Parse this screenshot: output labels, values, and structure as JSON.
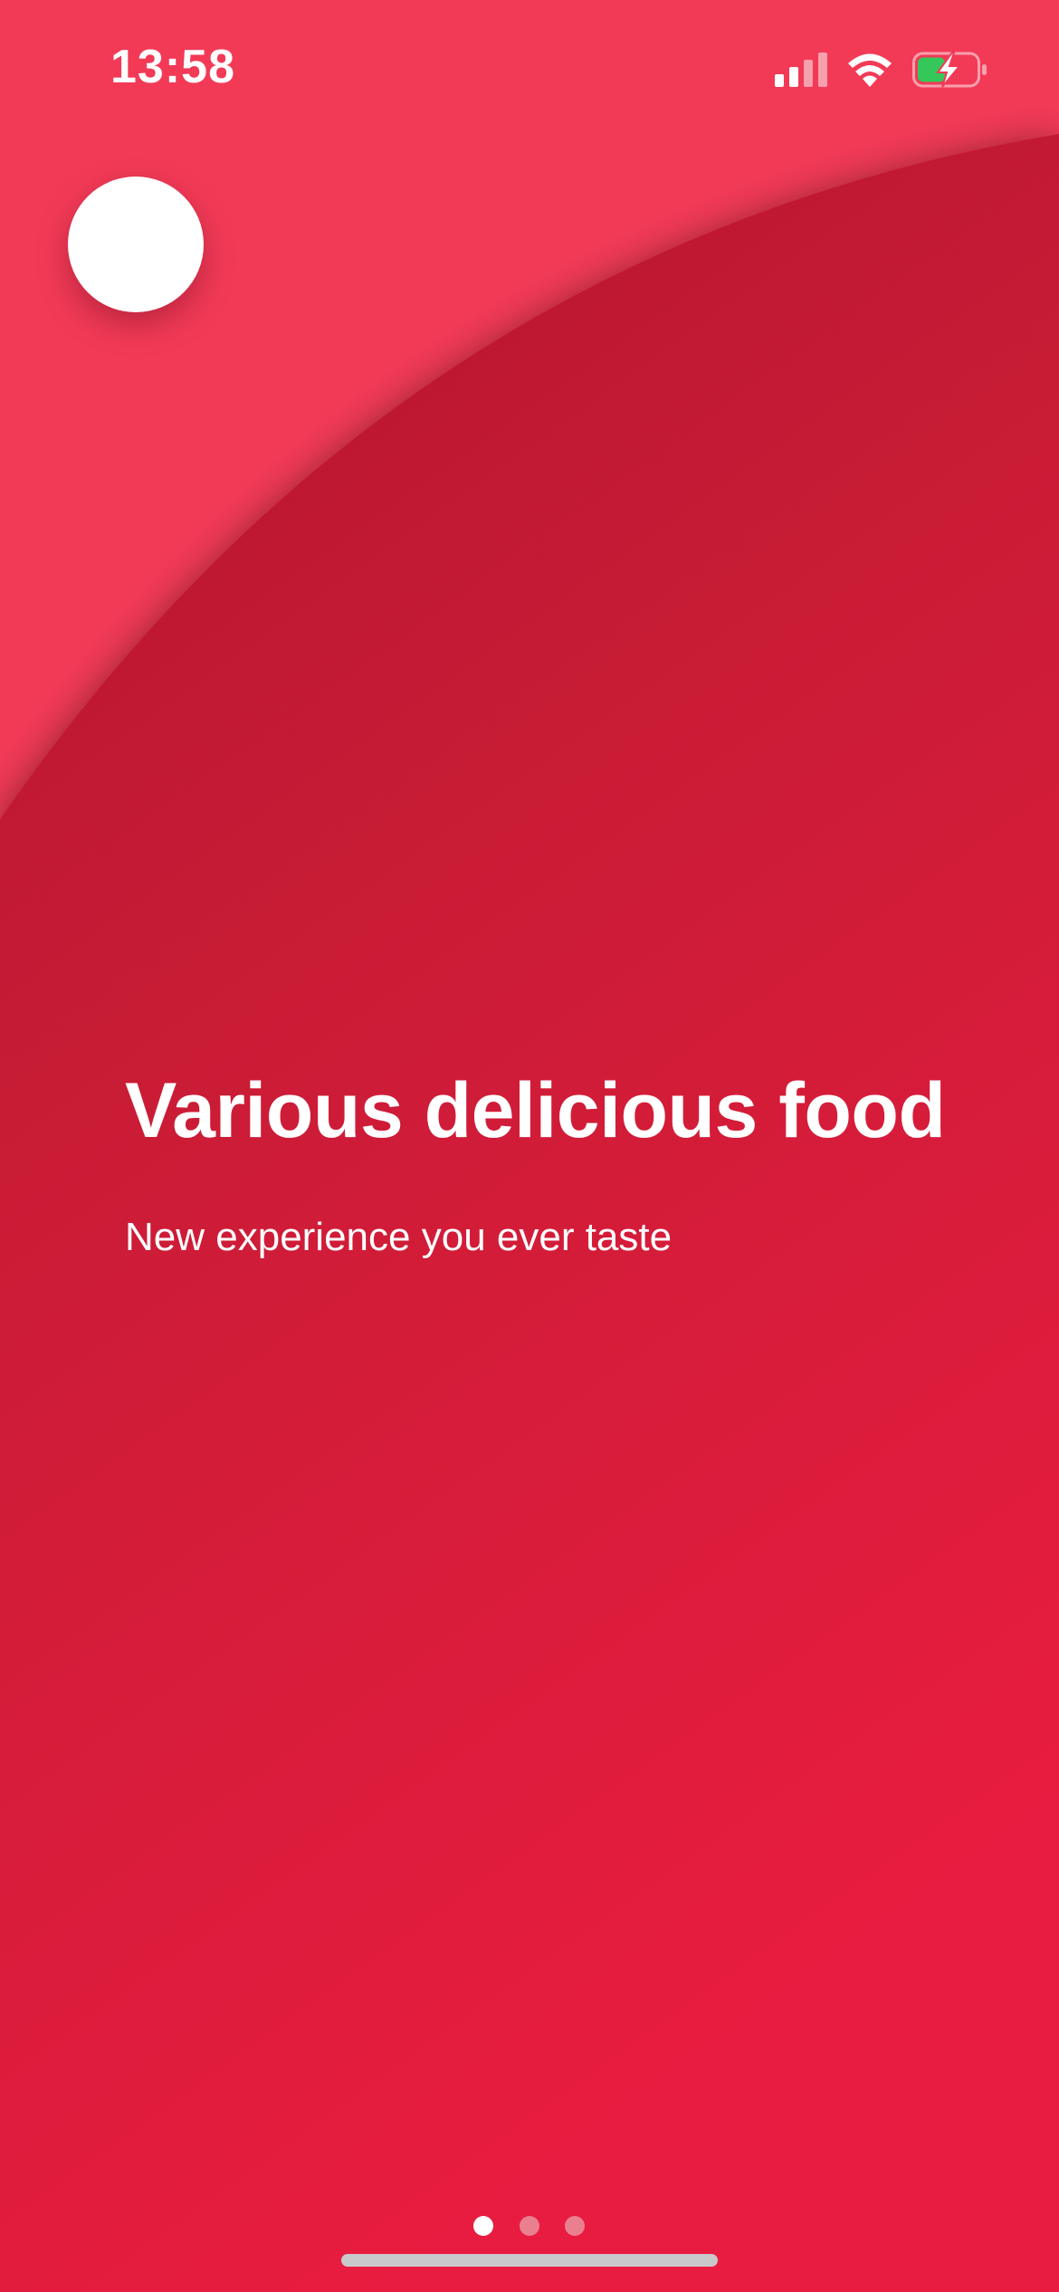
{
  "status_bar": {
    "time": "13:58",
    "signal_icon": "cellular-signal-icon",
    "wifi_icon": "wifi-icon",
    "battery_icon": "battery-charging-icon"
  },
  "onboarding": {
    "title": "Various delicious food",
    "subtitle": "New experience you ever taste",
    "page_indicator": {
      "total_pages": 3,
      "current_page": 1
    }
  },
  "colors": {
    "background_light": "#f23a57",
    "background_dark_top": "#b2182f",
    "background_dark_bottom": "#e81d3f",
    "text": "#ffffff",
    "dot_active": "#ffffff",
    "dot_inactive": "#ea7f90",
    "battery_fill": "#34c759"
  }
}
